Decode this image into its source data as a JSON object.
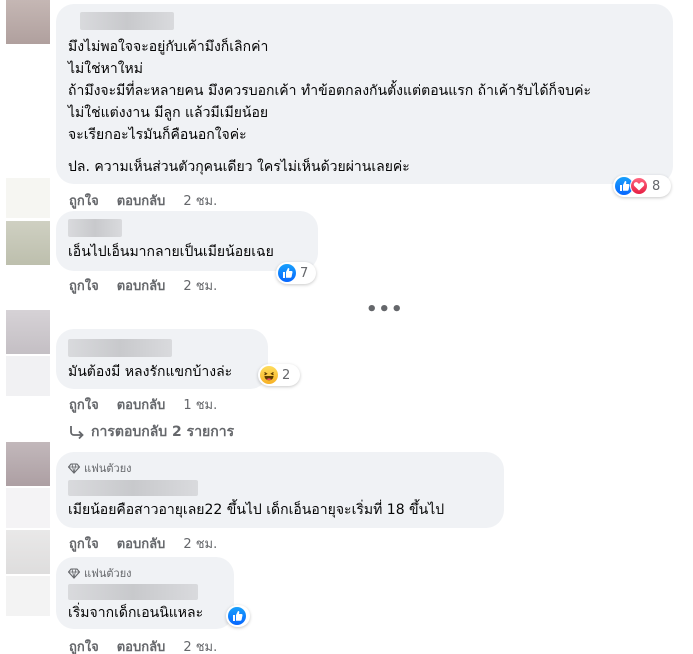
{
  "actions": {
    "like": "ถูกใจ",
    "reply": "ตอบกลับ"
  },
  "comments": [
    {
      "lines": [
        "มึงไม่พอใจจะอยู่กับเค้ามึงก็เลิกค่า",
        "ไม่ใช่หาใหม่",
        "ถ้ามึงจะมีที่ละหลายคน มึงควรบอกเค้า ทำข้อตกลงกันตั้งแต่ตอนแรก ถ้าเค้ารับได้ก็จบค่ะ",
        "ไม่ใช่แต่งงาน มีลูก แล้วมีเมียน้อย",
        "จะเรียกอะไรมันก็คือนอกใจค่ะ",
        "",
        "ปล. ความเห็นส่วนตัวกุคนเดียว ใครไม่เห็นด้วยผ่านเลยค่ะ"
      ],
      "reaction_count": "8",
      "reactions": [
        "like-icon",
        "love-icon"
      ],
      "time": "2 ชม."
    },
    {
      "text": "เอ็นไปเอ็นมากลายเป็นเมียน้อยเฉย",
      "reaction_count": "7",
      "reactions": [
        "like-icon"
      ],
      "time": "2 ชม."
    },
    {
      "text": "มันต้องมี หลงรักแขกบ้างล่ะ",
      "reaction_count": "2",
      "reactions": [
        "haha-icon"
      ],
      "time": "1 ชม."
    },
    {
      "badge": "แฟนตัวยง",
      "text": "เมียน้อยคือสาวอายุเลย22 ขึ้นไป เด็กเอ็นอายุจะเริ่มที่ 18 ขึ้นไป",
      "time": "2 ชม."
    },
    {
      "badge": "แฟนตัวยง",
      "text": "เริ่มจากเด็กเอนนิแหละ",
      "reactions": [
        "like-icon"
      ],
      "time": "2 ชม."
    }
  ],
  "replies_link": "การตอบกลับ 2 รายการ",
  "more_icon": "more-horizontal-icon",
  "colors": {
    "bubble": "#f0f2f5",
    "meta_text": "#65676b",
    "like_blue": "#1877f2",
    "love_red": "#f33e58",
    "haha_yellow": "#f7b125"
  }
}
